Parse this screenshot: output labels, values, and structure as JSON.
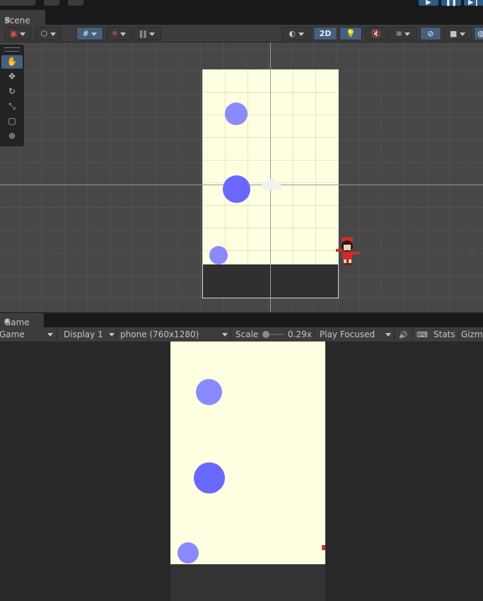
{
  "scene": {
    "tab_label": "Scene",
    "toolbar": {
      "dimension_toggle": "2D"
    },
    "tools": [
      {
        "name": "hand-tool",
        "icon": "✋"
      },
      {
        "name": "move-tool",
        "icon": "✥"
      },
      {
        "name": "rotate-tool",
        "icon": "↻"
      },
      {
        "name": "scale-tool",
        "icon": "⤡"
      },
      {
        "name": "rect-tool",
        "icon": "▢"
      },
      {
        "name": "transform-tool",
        "icon": "⊕"
      }
    ],
    "colors": {
      "background": "#474747",
      "camera_background": "#fefee0",
      "ball_light": "#8a8aff",
      "ball_dark": "#6868ff",
      "ground": "#303030"
    }
  },
  "game": {
    "tab_label": "Game",
    "view_mode": "Game",
    "display": "Display 1",
    "resolution": "phone (760x1280)",
    "scale_label": "Scale",
    "scale_value": "0.29x",
    "play_mode": "Play Focused",
    "stats_label": "Stats",
    "gizmos_label": "Gizm"
  }
}
